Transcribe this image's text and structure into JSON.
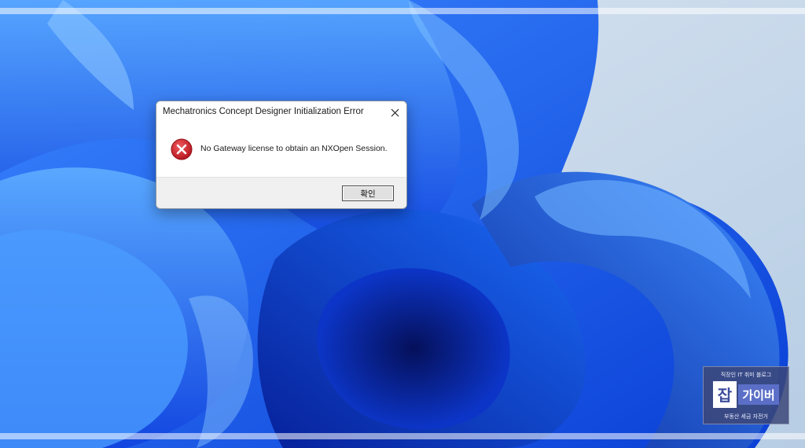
{
  "dialog": {
    "title": "Mechatronics Concept Designer Initialization Error",
    "message": "No Gateway license to obtain an NXOpen Session.",
    "ok_label": "확인",
    "icon": "error-icon",
    "close_icon": "close-icon"
  },
  "watermark": {
    "top_text": "직장인 IT 취미 블로그",
    "logo_main": "잡",
    "logo_side": "가이버",
    "bottom_text": "부동산 세금 자전거"
  },
  "colors": {
    "error_red": "#c8171e",
    "wallpaper_blue": "#1a5be8",
    "wallpaper_deep": "#0a2fb8",
    "sky": "#c9d9ea"
  }
}
